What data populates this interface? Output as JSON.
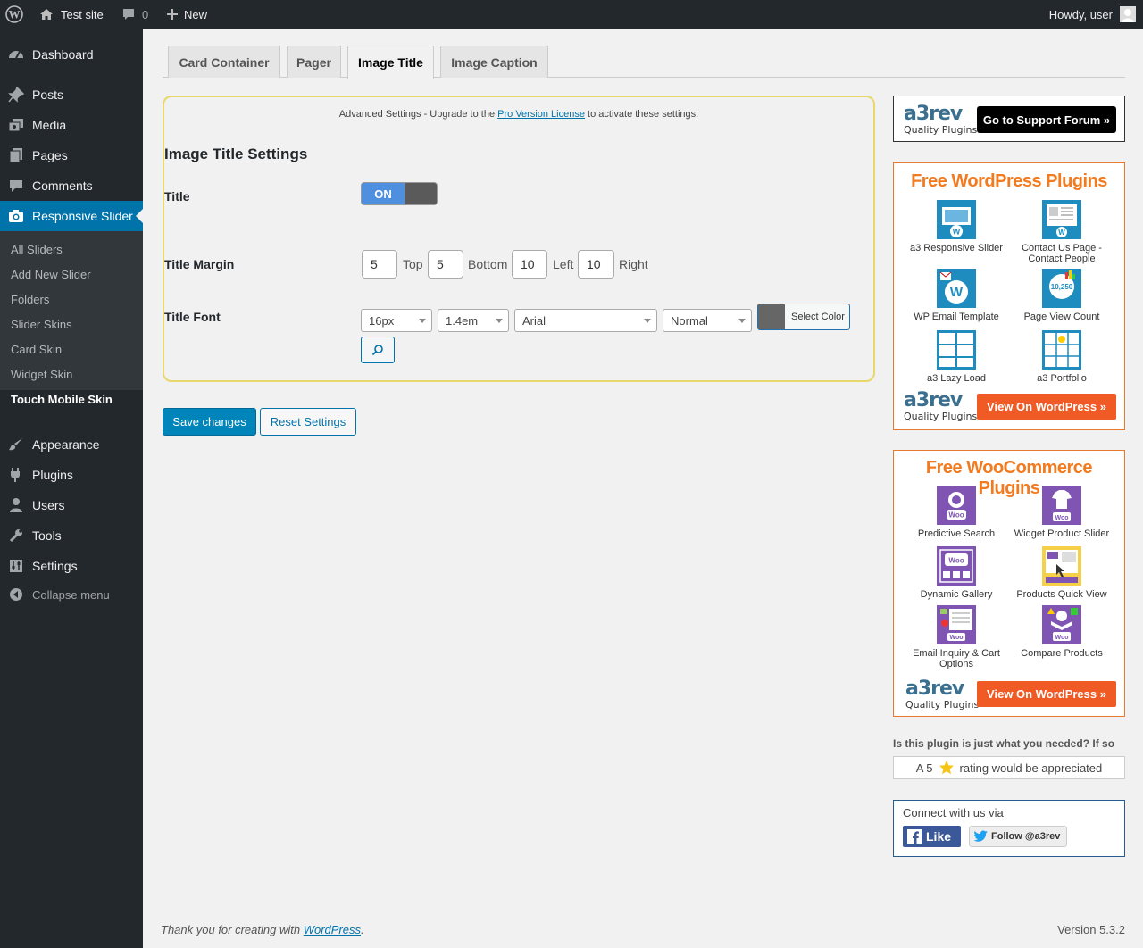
{
  "adminbar": {
    "site_name": "Test site",
    "comments_count": "0",
    "new_label": "New",
    "howdy": "Howdy, user"
  },
  "sidebar": {
    "items": [
      {
        "label": "Dashboard",
        "icon": "dashboard-icon"
      },
      {
        "label": "Posts",
        "icon": "pin-icon"
      },
      {
        "label": "Media",
        "icon": "media-icon"
      },
      {
        "label": "Pages",
        "icon": "pages-icon"
      },
      {
        "label": "Comments",
        "icon": "comment-icon"
      },
      {
        "label": "Responsive Slider",
        "icon": "camera-icon"
      },
      {
        "label": "Appearance",
        "icon": "brush-icon"
      },
      {
        "label": "Plugins",
        "icon": "plug-icon"
      },
      {
        "label": "Users",
        "icon": "user-icon"
      },
      {
        "label": "Tools",
        "icon": "wrench-icon"
      },
      {
        "label": "Settings",
        "icon": "settings-icon"
      }
    ],
    "submenu": [
      "All Sliders",
      "Add New Slider",
      "Folders",
      "Slider Skins",
      "Card Skin",
      "Widget Skin",
      "Touch Mobile Skin"
    ],
    "collapse_label": "Collapse menu"
  },
  "tabs": [
    "Card Container",
    "Pager",
    "Image Title",
    "Image Caption"
  ],
  "active_tab": "Image Title",
  "settings": {
    "upgrade_prefix": "Advanced Settings - Upgrade to the",
    "upgrade_link": "Pro Version License",
    "upgrade_suffix": "to activate these settings.",
    "section_title": "Image Title Settings",
    "title_label": "Title",
    "toggle_on": "ON",
    "margin_label": "Title Margin",
    "margin": {
      "top": "5",
      "top_label": "Top",
      "bottom": "5",
      "bottom_label": "Bottom",
      "left": "10",
      "left_label": "Left",
      "right": "10",
      "right_label": "Right"
    },
    "font_label": "Title Font",
    "font_size": "16px",
    "line_height": "1.4em",
    "font_family": "Arial",
    "font_style": "Normal",
    "color_button": "Select Color",
    "color_value": "#666666"
  },
  "buttons": {
    "save": "Save changes",
    "reset": "Reset Settings"
  },
  "right": {
    "logo_big": "a3rev",
    "logo_small": "Quality Plugins",
    "support_button": "Go to Support Forum »",
    "wp_plugins_title": "Free WordPress Plugins",
    "wp_plugins": [
      "a3 Responsive Slider",
      "Contact Us Page - Contact People",
      "WP Email Template",
      "Page View Count",
      "a3 Lazy Load",
      "a3 Portfolio"
    ],
    "view_on_wp": "View On WordPress »",
    "woo_plugins_title": "Free WooCommerce Plugins",
    "woo_plugins": [
      "Predictive Search",
      "Widget Product Slider",
      "Dynamic Gallery",
      "Products Quick View",
      "Email Inquiry & Cart Options",
      "Compare Products"
    ],
    "rating_question": "Is this plugin is just what you needed? If so",
    "rating_prefix": "A 5",
    "rating_suffix": "rating would be appreciated",
    "connect_label": "Connect with us via",
    "fb_like": "Like",
    "twitter_follow": "Follow @a3rev"
  },
  "footer": {
    "thanks_prefix": "Thank you for creating with",
    "wp_link": "WordPress",
    "thanks_suffix": ".",
    "version": "Version 5.3.2"
  },
  "colors": {
    "admin_dark": "#23282d",
    "accent": "#0073aa",
    "orange": "#f05a24",
    "woo_purple": "#7f54b3"
  }
}
